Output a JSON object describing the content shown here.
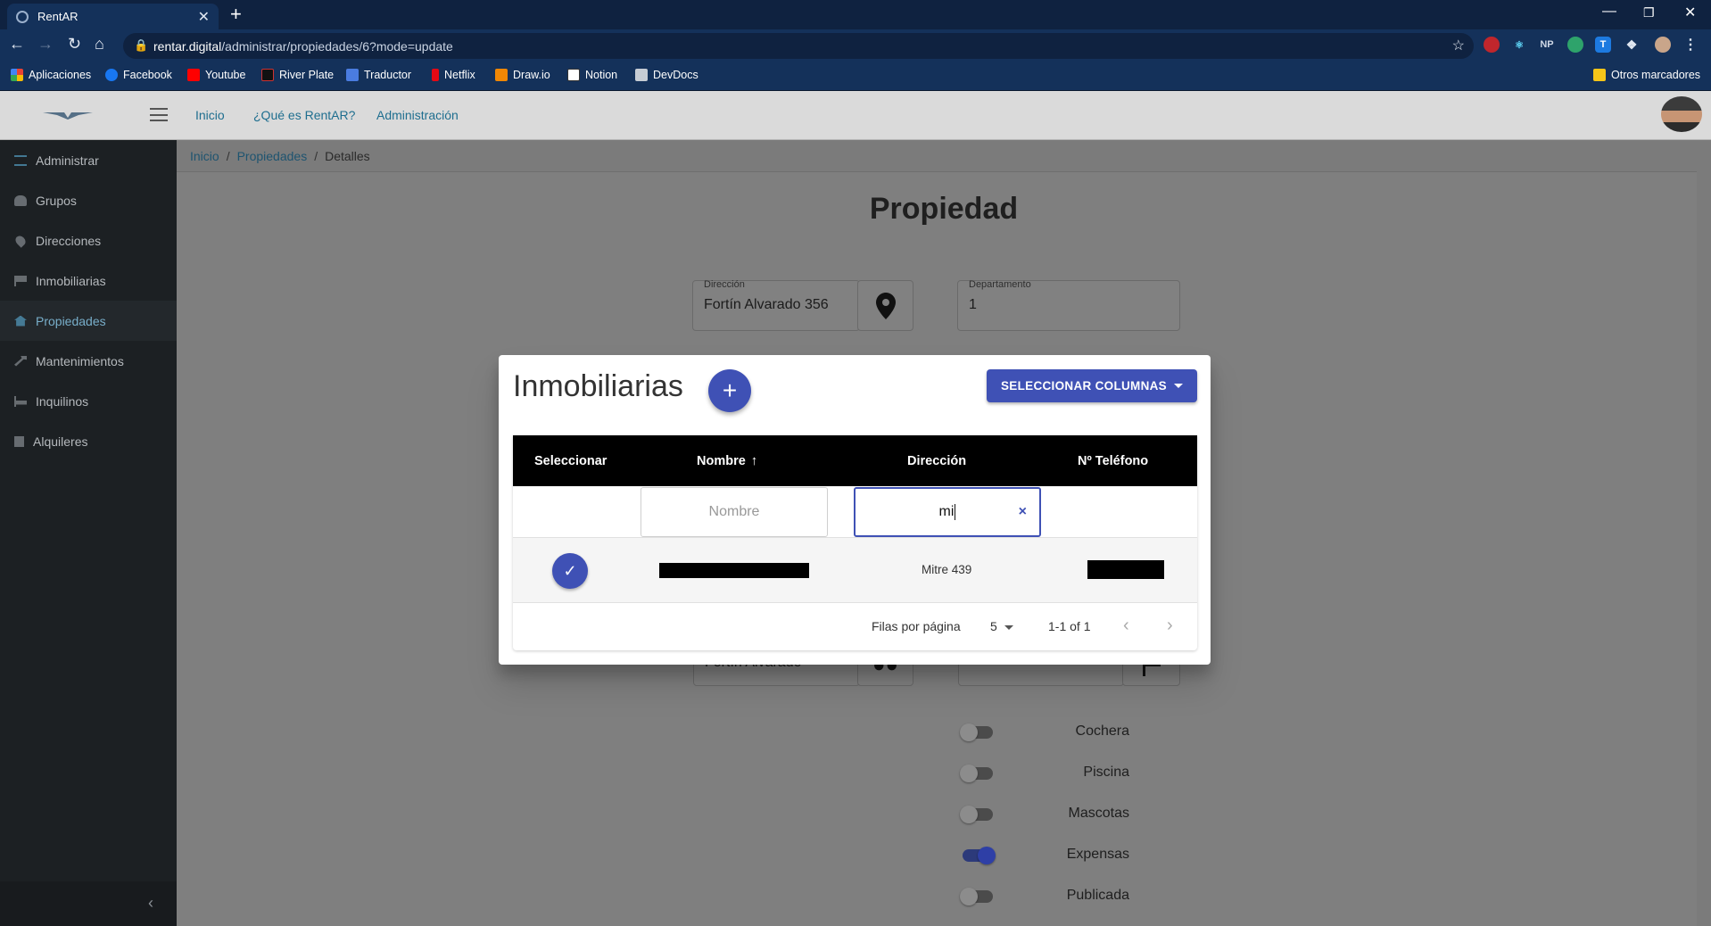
{
  "browser": {
    "tab_title": "RentAR",
    "tab_close": "✕",
    "new_tab": "+",
    "url_host": "rentar.digital",
    "url_path": "/administrar/propiedades/6?mode=update",
    "bookmarks": [
      "Aplicaciones",
      "Facebook",
      "Youtube",
      "River Plate",
      "Traductor",
      "Netflix",
      "Draw.io",
      "Notion",
      "DevDocs"
    ],
    "other_bookmarks": "Otros marcadores",
    "extensions": [
      "NP",
      "T"
    ]
  },
  "topnav": {
    "links": [
      "Inicio",
      "¿Qué es RentAR?",
      "Administración"
    ]
  },
  "sidebar": {
    "items": [
      {
        "label": "Administrar",
        "icon": "list-icon",
        "color": "#4d8fb0"
      },
      {
        "label": "Grupos",
        "icon": "users-icon",
        "color": "#7a7f84"
      },
      {
        "label": "Direcciones",
        "icon": "map-marker-icon",
        "color": "#7a7f84"
      },
      {
        "label": "Inmobiliarias",
        "icon": "flag-icon",
        "color": "#7a7f84"
      },
      {
        "label": "Propiedades",
        "icon": "home-icon",
        "color": "#4d8fb0"
      },
      {
        "label": "Mantenimientos",
        "icon": "hammer-icon",
        "color": "#7a7f84"
      },
      {
        "label": "Inquilinos",
        "icon": "bed-icon",
        "color": "#7a7f84"
      },
      {
        "label": "Alquileres",
        "icon": "building-icon",
        "color": "#7a7f84"
      }
    ],
    "active": "Propiedades",
    "collapse": "‹"
  },
  "breadcrumb": [
    "Inicio",
    "Propiedades",
    "Detalles"
  ],
  "page": {
    "title": "Propiedad",
    "direccion": {
      "label": "Dirección",
      "value": "Fortín Alvarado 356"
    },
    "departamento": {
      "label": "Departamento",
      "value": "1"
    },
    "grupo_value": "Fortín Alvarado",
    "toggles": [
      {
        "label": "Cochera",
        "on": false
      },
      {
        "label": "Piscina",
        "on": false
      },
      {
        "label": "Mascotas",
        "on": false
      },
      {
        "label": "Expensas",
        "on": true
      },
      {
        "label": "Publicada",
        "on": false
      }
    ]
  },
  "dialog": {
    "title": "Inmobiliarias",
    "add": "+",
    "columns_button": "SELECCIONAR COLUMNAS",
    "headers": [
      "Seleccionar",
      "Nombre",
      "Dirección",
      "Nº Teléfono"
    ],
    "sort_arrow": "↑",
    "filter_nombre_placeholder": "Nombre",
    "filter_direccion_value": "mi",
    "filter_clear": "×",
    "rows": [
      {
        "direccion": "Mitre 439",
        "selected": true
      }
    ],
    "check": "✓",
    "pagination": {
      "rows_per_page_label": "Filas por página",
      "rows_per_page": "5",
      "range": "1-1 of 1",
      "prev": "‹",
      "next": "›"
    }
  },
  "colors": {
    "primary": "#3f51b5",
    "chrome": "#14315a",
    "sidebar": "#1c2023"
  }
}
